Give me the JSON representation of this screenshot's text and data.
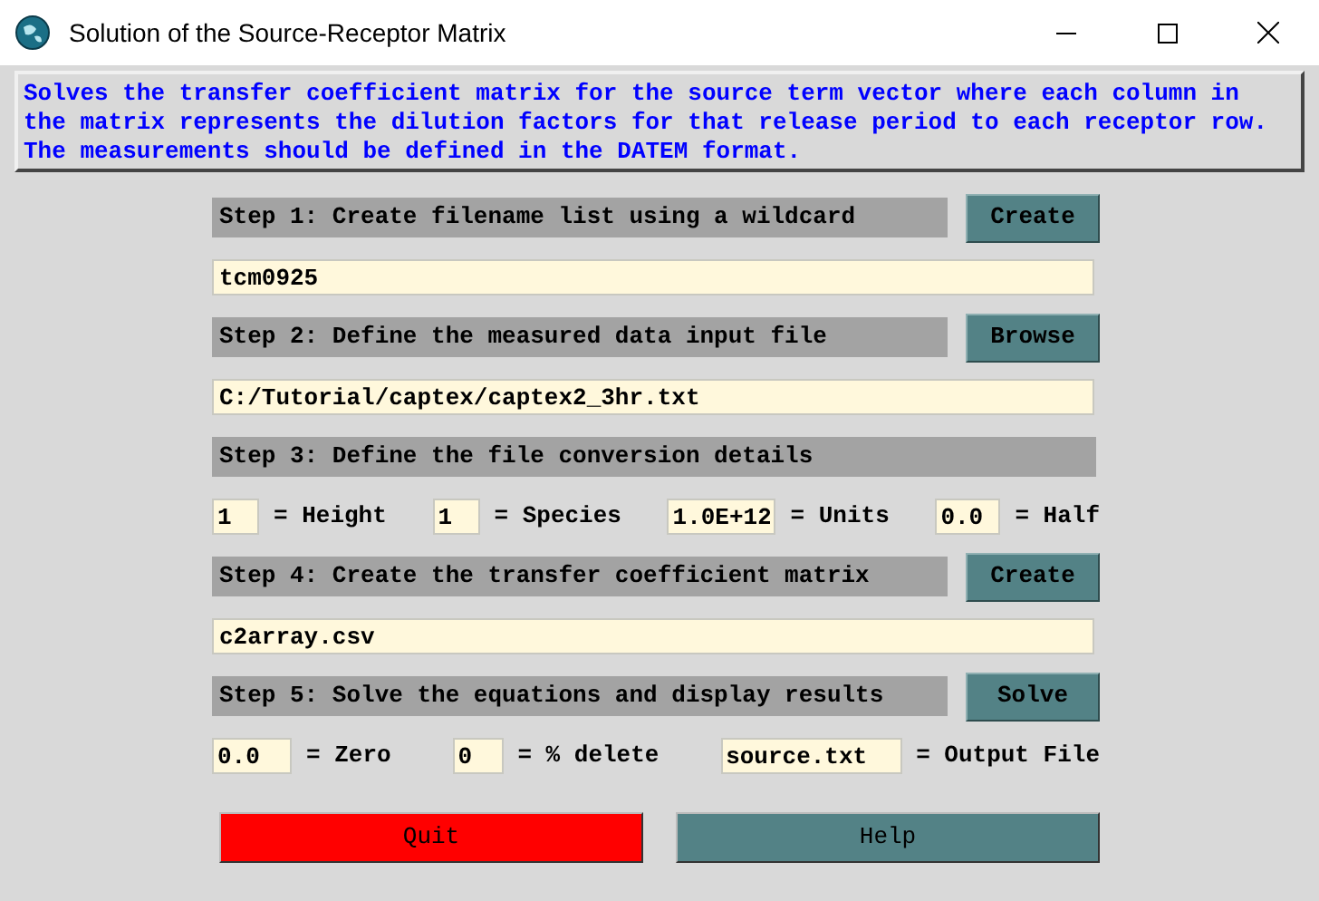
{
  "window": {
    "title": "Solution of the Source-Receptor Matrix"
  },
  "description": "Solves the transfer coefficient matrix for the source term vector where each column in the matrix represents the dilution factors for that release period to each receptor row. The measurements should be defined in the DATEM format.",
  "steps": [
    {
      "label": "Step 1: Create filename list using a wildcard",
      "button": "Create",
      "field": "tcm0925"
    },
    {
      "label": "Step 2: Define the measured data input file",
      "button": "Browse",
      "field": "C:/Tutorial/captex/captex2_3hr.txt"
    },
    {
      "label": "Step 3: Define the file conversion details",
      "params": [
        {
          "value": "1",
          "label": "= Height"
        },
        {
          "value": "1",
          "label": "= Species"
        },
        {
          "value": "1.0E+12",
          "label": "= Units"
        },
        {
          "value": "0.0",
          "label": "= Half"
        }
      ]
    },
    {
      "label": "Step 4: Create the transfer coefficient matrix",
      "button": "Create",
      "field": "c2array.csv"
    },
    {
      "label": "Step 5: Solve the equations and display results",
      "button": "Solve",
      "params": [
        {
          "value": "0.0",
          "label": "= Zero"
        },
        {
          "value": "0",
          "label": "= % delete"
        },
        {
          "value": "source.txt",
          "label": "= Output File"
        }
      ]
    }
  ],
  "footer_buttons": [
    {
      "label": "Quit",
      "kind": "danger"
    },
    {
      "label": "Help",
      "kind": "normal"
    }
  ]
}
